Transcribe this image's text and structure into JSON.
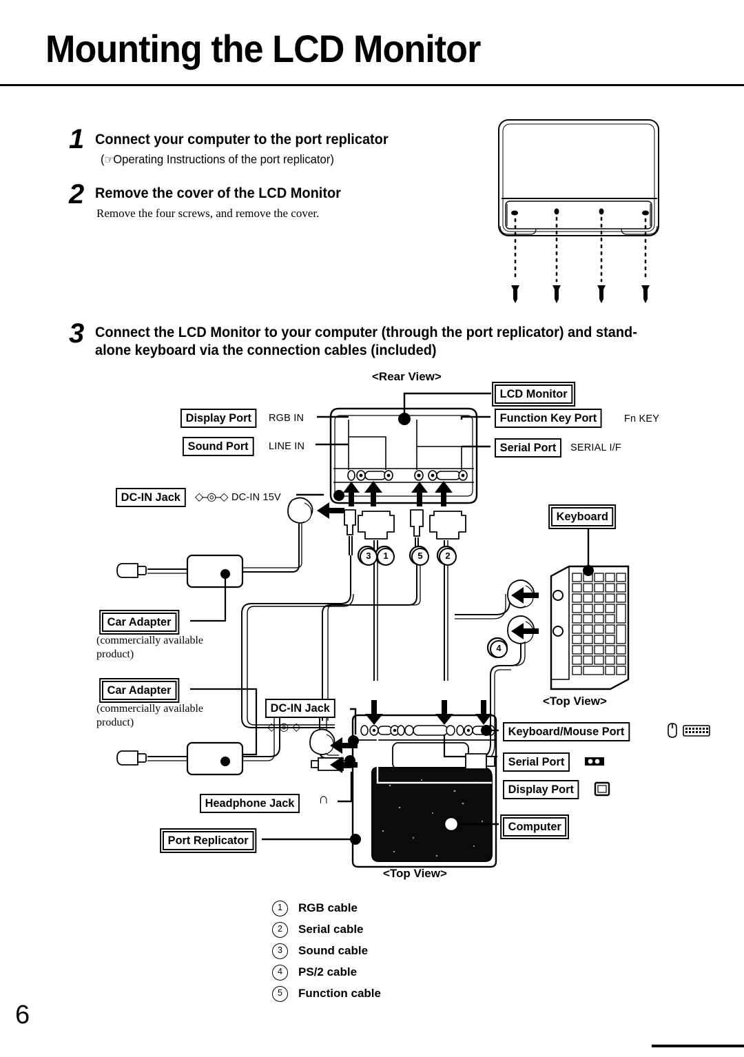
{
  "page": {
    "title": "Mounting the LCD Monitor",
    "number": "6"
  },
  "steps": [
    {
      "num": "1",
      "heading": "Connect your computer to the port replicator",
      "sub": "Operating Instructions of the port replicator",
      "sub_prefix": "(",
      "sub_suffix": ")",
      "hand_icon": "pointing-hand-icon"
    },
    {
      "num": "2",
      "heading": "Remove the cover of the LCD Monitor",
      "sub": "Remove the four screws, and remove the cover."
    },
    {
      "num": "3",
      "heading_line1": "Connect the LCD Monitor to your computer (through the port replicator) and stand-",
      "heading_line2": "alone keyboard via the connection cables (included)"
    }
  ],
  "diagram": {
    "captions": {
      "rear_view": "<Rear View>",
      "top_view_keyboard": "<Top View>",
      "top_view_computer": "<Top View>"
    },
    "monitor_ports": {
      "display_port": {
        "label": "Display Port",
        "signal": "RGB IN"
      },
      "sound_port": {
        "label": "Sound Port",
        "signal": "LINE IN"
      },
      "dc_in_jack": {
        "label": "DC-IN Jack",
        "signal": "DC-IN 15V",
        "symbol": "dc-polarity-icon"
      },
      "function_key_port": {
        "label": "Function Key Port",
        "signal": "Fn KEY"
      },
      "serial_port": {
        "label": "Serial Port",
        "signal": "SERIAL I/F"
      }
    },
    "devices": {
      "lcd_monitor": "LCD Monitor",
      "keyboard": "Keyboard",
      "computer": "Computer",
      "port_replicator": "Port Replicator"
    },
    "car_adapters": [
      {
        "label": "Car Adapter",
        "note_line1": "(commercially available",
        "note_line2": "product)"
      },
      {
        "label": "Car Adapter",
        "note_line1": "(commercially available",
        "note_line2": "product)"
      }
    ],
    "replicator_ports": {
      "dc_in_jack": {
        "label": "DC-IN Jack",
        "symbol": "dc-polarity-icon"
      },
      "headphone_jack": {
        "label": "Headphone Jack",
        "symbol": "headphone-icon"
      },
      "keyboard_mouse_port": {
        "label": "Keyboard/Mouse Port",
        "symbol": "mouse-keyboard-icon"
      },
      "serial_port": {
        "label": "Serial Port",
        "symbol": "serial-connector-icon"
      },
      "display_port": {
        "label": "Display Port",
        "symbol": "monitor-icon"
      }
    },
    "cable_markers": [
      "3",
      "1",
      "5",
      "2",
      "4"
    ]
  },
  "legend": [
    {
      "mark": "1",
      "text": "RGB cable"
    },
    {
      "mark": "2",
      "text": "Serial cable"
    },
    {
      "mark": "3",
      "text": "Sound cable"
    },
    {
      "mark": "4",
      "text": "PS/2 cable"
    },
    {
      "mark": "5",
      "text": "Function cable"
    }
  ]
}
